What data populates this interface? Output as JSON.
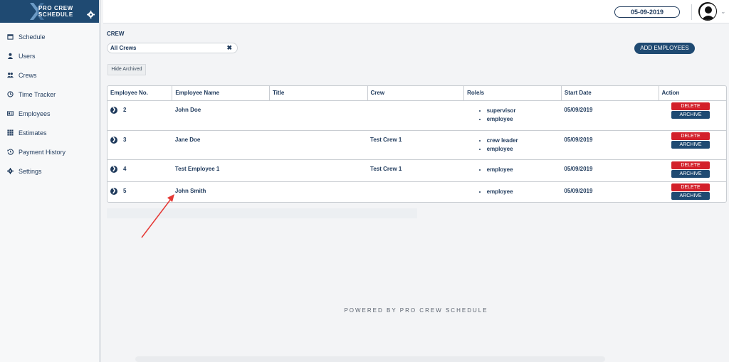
{
  "brand": {
    "line1": "PRO CREW",
    "line2": "SCHEDULE"
  },
  "sidebar": {
    "items": [
      {
        "label": "Schedule",
        "icon": "calendar-icon"
      },
      {
        "label": "Users",
        "icon": "user-icon"
      },
      {
        "label": "Crews",
        "icon": "users-group-icon"
      },
      {
        "label": "Time Tracker",
        "icon": "clock-icon"
      },
      {
        "label": "Employees",
        "icon": "id-card-icon"
      },
      {
        "label": "Estimates",
        "icon": "grid-icon"
      },
      {
        "label": "Payment History",
        "icon": "history-icon"
      },
      {
        "label": "Settings",
        "icon": "gear-icon"
      }
    ]
  },
  "header": {
    "date": "05-09-2019"
  },
  "crew": {
    "label": "CREW",
    "selected": "All Crews",
    "add_button": "ADD EMPLOYEES",
    "hide_archived": "Hide Archived"
  },
  "table": {
    "columns": [
      "Employee No.",
      "Employee Name",
      "Title",
      "Crew",
      "Role/s",
      "Start Date",
      "Action"
    ],
    "rows": [
      {
        "no": "2",
        "name": "John Doe",
        "title": "",
        "crew": "",
        "roles": [
          "supervisor",
          "employee"
        ],
        "start": "05/09/2019"
      },
      {
        "no": "3",
        "name": "Jane Doe",
        "title": "",
        "crew": "Test Crew 1",
        "roles": [
          "crew leader",
          "employee"
        ],
        "start": "05/09/2019"
      },
      {
        "no": "4",
        "name": "Test Employee 1",
        "title": "",
        "crew": "Test Crew 1",
        "roles": [
          "employee"
        ],
        "start": "05/09/2019"
      },
      {
        "no": "5",
        "name": "John Smith",
        "title": "",
        "crew": "",
        "roles": [
          "employee"
        ],
        "start": "05/09/2019"
      }
    ],
    "delete_label": "DELETE",
    "archive_label": "ARCHIVE"
  },
  "footer": {
    "powered": "POWERED BY PRO CREW SCHEDULE"
  },
  "colors": {
    "brand": "#1f4a72",
    "text": "#1f3a5c",
    "danger": "#d3202a",
    "annotation": "#e53935"
  }
}
